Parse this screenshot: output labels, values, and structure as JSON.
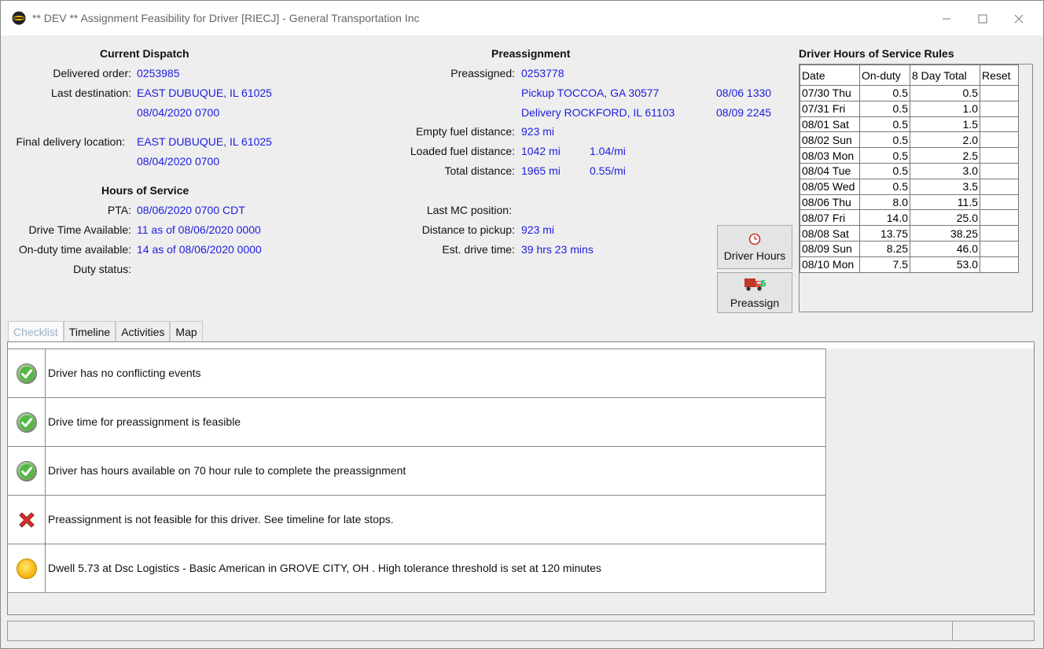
{
  "window": {
    "title": "** DEV ** Assignment Feasibility for Driver [RIECJ] - General Transportation Inc"
  },
  "current_dispatch": {
    "header": "Current Dispatch",
    "delivered_order_label": "Delivered order:",
    "delivered_order": "0253985",
    "last_destination_label": "Last destination:",
    "last_destination": "EAST DUBUQUE, IL 61025",
    "last_destination_time": "08/04/2020 0700",
    "final_delivery_label": "Final delivery location:",
    "final_delivery": "EAST DUBUQUE, IL 61025",
    "final_delivery_time": "08/04/2020 0700"
  },
  "hours_of_service": {
    "header": "Hours of Service",
    "pta_label": "PTA:",
    "pta": "08/06/2020 0700 CDT",
    "drive_time_label": "Drive Time Available:",
    "drive_time": "11 as of 08/06/2020 0000",
    "onduty_label": "On-duty time available:",
    "onduty": "14 as of 08/06/2020 0000",
    "duty_status_label": "Duty status:"
  },
  "preassignment": {
    "header": "Preassignment",
    "preassigned_label": "Preassigned:",
    "preassigned": "0253778",
    "pickup": "Pickup TOCCOA, GA 30577",
    "pickup_time": "08/06 1330",
    "delivery": "Delivery ROCKFORD, IL 61103",
    "delivery_time": "08/09 2245",
    "empty_fuel_label": "Empty fuel distance:",
    "empty_fuel": "923 mi",
    "loaded_fuel_label": "Loaded fuel distance:",
    "loaded_fuel": "1042 mi",
    "loaded_rate": "1.04/mi",
    "total_distance_label": "Total distance:",
    "total_distance": "1965 mi",
    "total_rate": "0.55/mi",
    "last_mc_label": "Last MC position:",
    "distance_pickup_label": "Distance to pickup:",
    "distance_pickup": "923 mi",
    "est_drive_label": "Est. drive time:",
    "est_drive": "39 hrs 23 mins"
  },
  "hos_rules": {
    "header": "Driver Hours of Service Rules",
    "columns": [
      "Date",
      "On-duty",
      "8 Day Total",
      "Reset"
    ],
    "rows": [
      [
        "07/30 Thu",
        "0.5",
        "0.5",
        ""
      ],
      [
        "07/31 Fri",
        "0.5",
        "1.0",
        ""
      ],
      [
        "08/01 Sat",
        "0.5",
        "1.5",
        ""
      ],
      [
        "08/02 Sun",
        "0.5",
        "2.0",
        ""
      ],
      [
        "08/03 Mon",
        "0.5",
        "2.5",
        ""
      ],
      [
        "08/04 Tue",
        "0.5",
        "3.0",
        ""
      ],
      [
        "08/05 Wed",
        "0.5",
        "3.5",
        ""
      ],
      [
        "08/06 Thu",
        "8.0",
        "11.5",
        ""
      ],
      [
        "08/07 Fri",
        "14.0",
        "25.0",
        ""
      ],
      [
        "08/08 Sat",
        "13.75",
        "38.25",
        ""
      ],
      [
        "08/09 Sun",
        "8.25",
        "46.0",
        ""
      ],
      [
        "08/10 Mon",
        "7.5",
        "53.0",
        ""
      ]
    ]
  },
  "buttons": {
    "driver_hours": "Driver Hours",
    "preassign": "Preassign"
  },
  "tabs": [
    "Checklist",
    "Timeline",
    "Activities",
    "Map"
  ],
  "checklist": [
    {
      "status": "ok",
      "icon": "green-check-icon",
      "text": "Driver has no conflicting events"
    },
    {
      "status": "ok",
      "icon": "green-check-icon",
      "text": "Drive time for preassignment is feasible"
    },
    {
      "status": "ok",
      "icon": "green-check-icon",
      "text": "Driver has hours available on 70 hour rule to complete the preassignment"
    },
    {
      "status": "fail",
      "icon": "red-x-icon",
      "text": "Preassignment is not feasible for this driver.  See timeline for late stops."
    },
    {
      "status": "warn",
      "icon": "yellow-circle-icon",
      "text": "Dwell 5.73 at  Dsc Logistics - Basic American in GROVE CITY, OH . High tolerance threshold is set at 120 minutes"
    }
  ],
  "colors": {
    "value_text": "#1d1de0",
    "ok": "#4caf50",
    "fail": "#d32f2f",
    "warn": "#ffc107"
  }
}
